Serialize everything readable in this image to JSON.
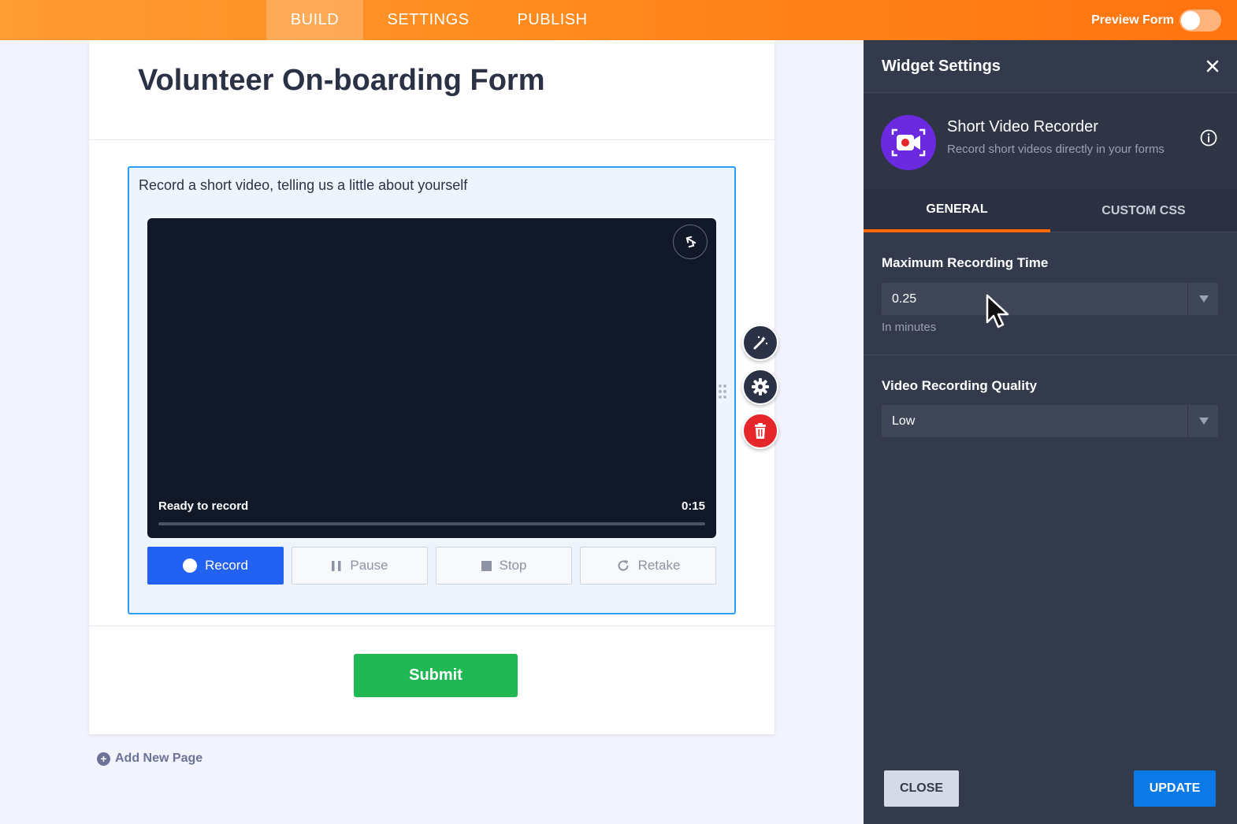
{
  "topbar": {
    "tabs": [
      {
        "label": "BUILD",
        "active": true
      },
      {
        "label": "SETTINGS",
        "active": false
      },
      {
        "label": "PUBLISH",
        "active": false
      }
    ],
    "preview_label": "Preview Form",
    "preview_enabled": false,
    "gradient_colors": [
      "#ff9c34",
      "#ff7410"
    ]
  },
  "form": {
    "title": "Volunteer On-boarding Form",
    "widget": {
      "question": "Record a short video, telling us a little about yourself",
      "status": "Ready to record",
      "time": "0:15",
      "progress": 0,
      "buttons": {
        "record": "Record",
        "pause": "Pause",
        "stop": "Stop",
        "retake": "Retake"
      }
    },
    "submit_label": "Submit",
    "add_page_label": "Add New Page"
  },
  "panel": {
    "title": "Widget Settings",
    "widget_name": "Short Video Recorder",
    "widget_description": "Record short videos directly in your forms",
    "tabs": [
      {
        "label": "GENERAL",
        "active": true
      },
      {
        "label": "CUSTOM CSS",
        "active": false
      }
    ],
    "fields": [
      {
        "label": "Maximum Recording Time",
        "value": "0.25",
        "help": "In minutes"
      },
      {
        "label": "Video Recording Quality",
        "value": "Low"
      }
    ],
    "close_label": "CLOSE",
    "update_label": "UPDATE"
  },
  "colors": {
    "accent_orange": "#ff6a00",
    "record_blue": "#2361f2",
    "submit_green": "#1fb854",
    "update_blue": "#0b79e6",
    "delete_red": "#e5262b",
    "panel_bg": "#333a4b",
    "widget_purple": "#6b29e0"
  },
  "icons": {
    "swap_camera": "swap-camera-icon",
    "magic": "magic-wand-icon",
    "settings": "gear-icon",
    "delete": "trash-icon",
    "info": "info-icon",
    "close": "close-icon",
    "add": "plus-circle-icon"
  }
}
